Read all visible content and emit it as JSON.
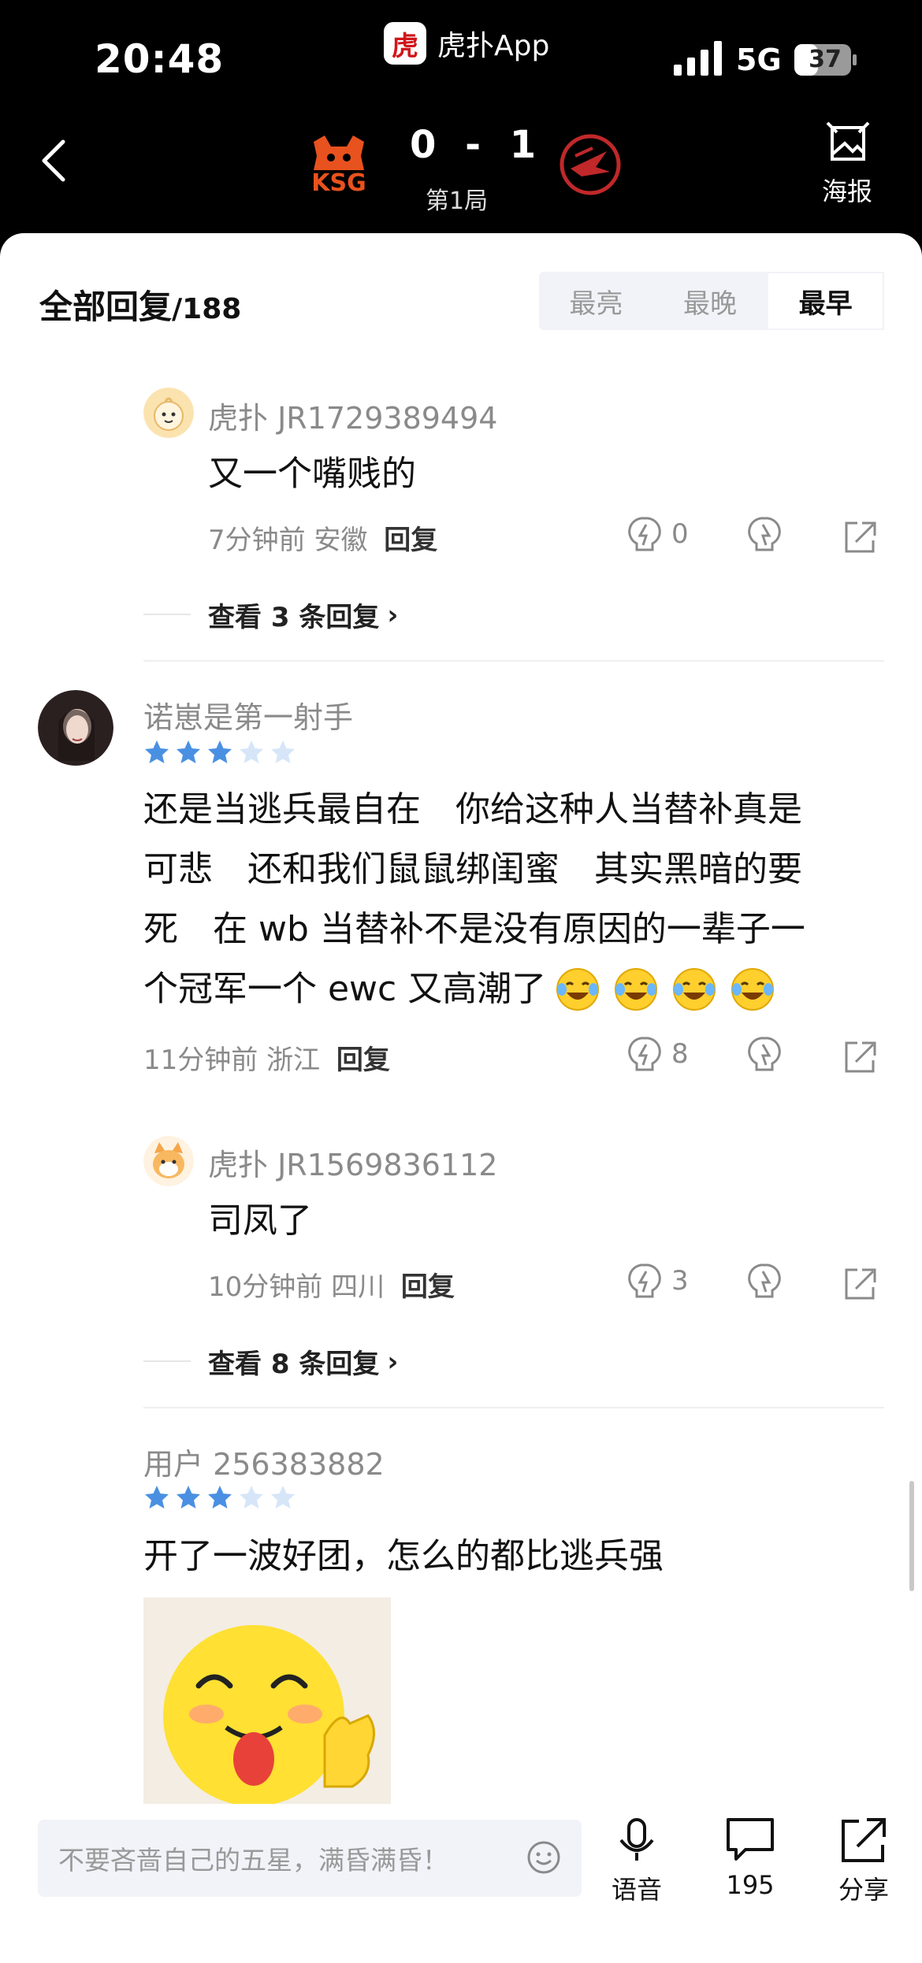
{
  "status_bar": {
    "time": "20:48",
    "app_name": "虎扑App",
    "app_logo_text": "虎扑",
    "network": "5G",
    "battery": "37"
  },
  "header": {
    "score": "0 - 1",
    "game": "第1局",
    "poster_label": "海报",
    "left_team_logo_text": "KSG"
  },
  "replies": {
    "title": "全部回复",
    "count": "/188",
    "sort_tabs": [
      "最亮",
      "最晚",
      "最早"
    ],
    "active_sort": "最早"
  },
  "comments": [
    {
      "user": "虎扑 JR1729389494",
      "text": "又一个嘴贱的",
      "time": "7分钟前",
      "location": "安徽",
      "reply_label": "回复",
      "likes": "0",
      "view_more": "查看 3 条回复"
    },
    {
      "user": "诺崽是第一射手",
      "rating": 3,
      "text_lines": [
        "还是当逃兵最自在　你给这种人当替补真是",
        "可悲　还和我们鼠鼠绑闺蜜　其实黑暗的要",
        "死　在 wb 当替补不是没有原因的一辈子一",
        "个冠军一个 ewc 又高潮了"
      ],
      "time": "11分钟前",
      "location": "浙江",
      "reply_label": "回复",
      "likes": "8"
    },
    {
      "user": "虎扑 JR1569836112",
      "text": "司凤了",
      "time": "10分钟前",
      "location": "四川",
      "reply_label": "回复",
      "likes": "3",
      "view_more": "查看 8 条回复"
    },
    {
      "user": "用户 256383882",
      "rating": 3,
      "text": "开了一波好团，怎么的都比逃兵强"
    }
  ],
  "bottom_bar": {
    "input_placeholder": "不要吝啬自己的五星，满昏满昏！",
    "voice_label": "语音",
    "comment_count": "195",
    "share_label": "分享"
  },
  "colors": {
    "brand_red": "#d0161a",
    "star_blue": "#4a90e2",
    "star_empty": "#d6e6f8",
    "link_gray": "#8a8a8a"
  }
}
